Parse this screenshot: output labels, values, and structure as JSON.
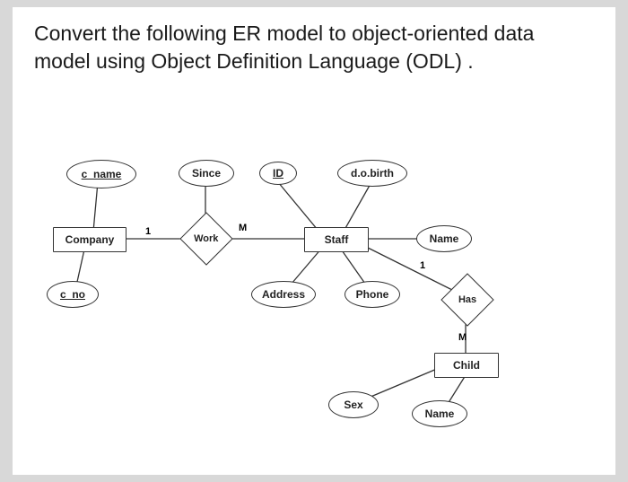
{
  "question": "Convert the following ER model to object-oriented data model using Object Definition Language (ODL) .",
  "er": {
    "entities": {
      "company": "Company",
      "staff": "Staff",
      "child": "Child"
    },
    "relationships": {
      "work": "Work",
      "has": "Has"
    },
    "attributes": {
      "c_name": "c_name",
      "c_no": "c_no",
      "since": "Since",
      "id": "ID",
      "dob": "d.o.birth",
      "name": "Name",
      "address": "Address",
      "phone": "Phone",
      "sex": "Sex",
      "child_name": "Name"
    },
    "cardinality": {
      "company_work": "1",
      "work_staff": "M",
      "staff_has": "1",
      "has_child": "M"
    }
  }
}
